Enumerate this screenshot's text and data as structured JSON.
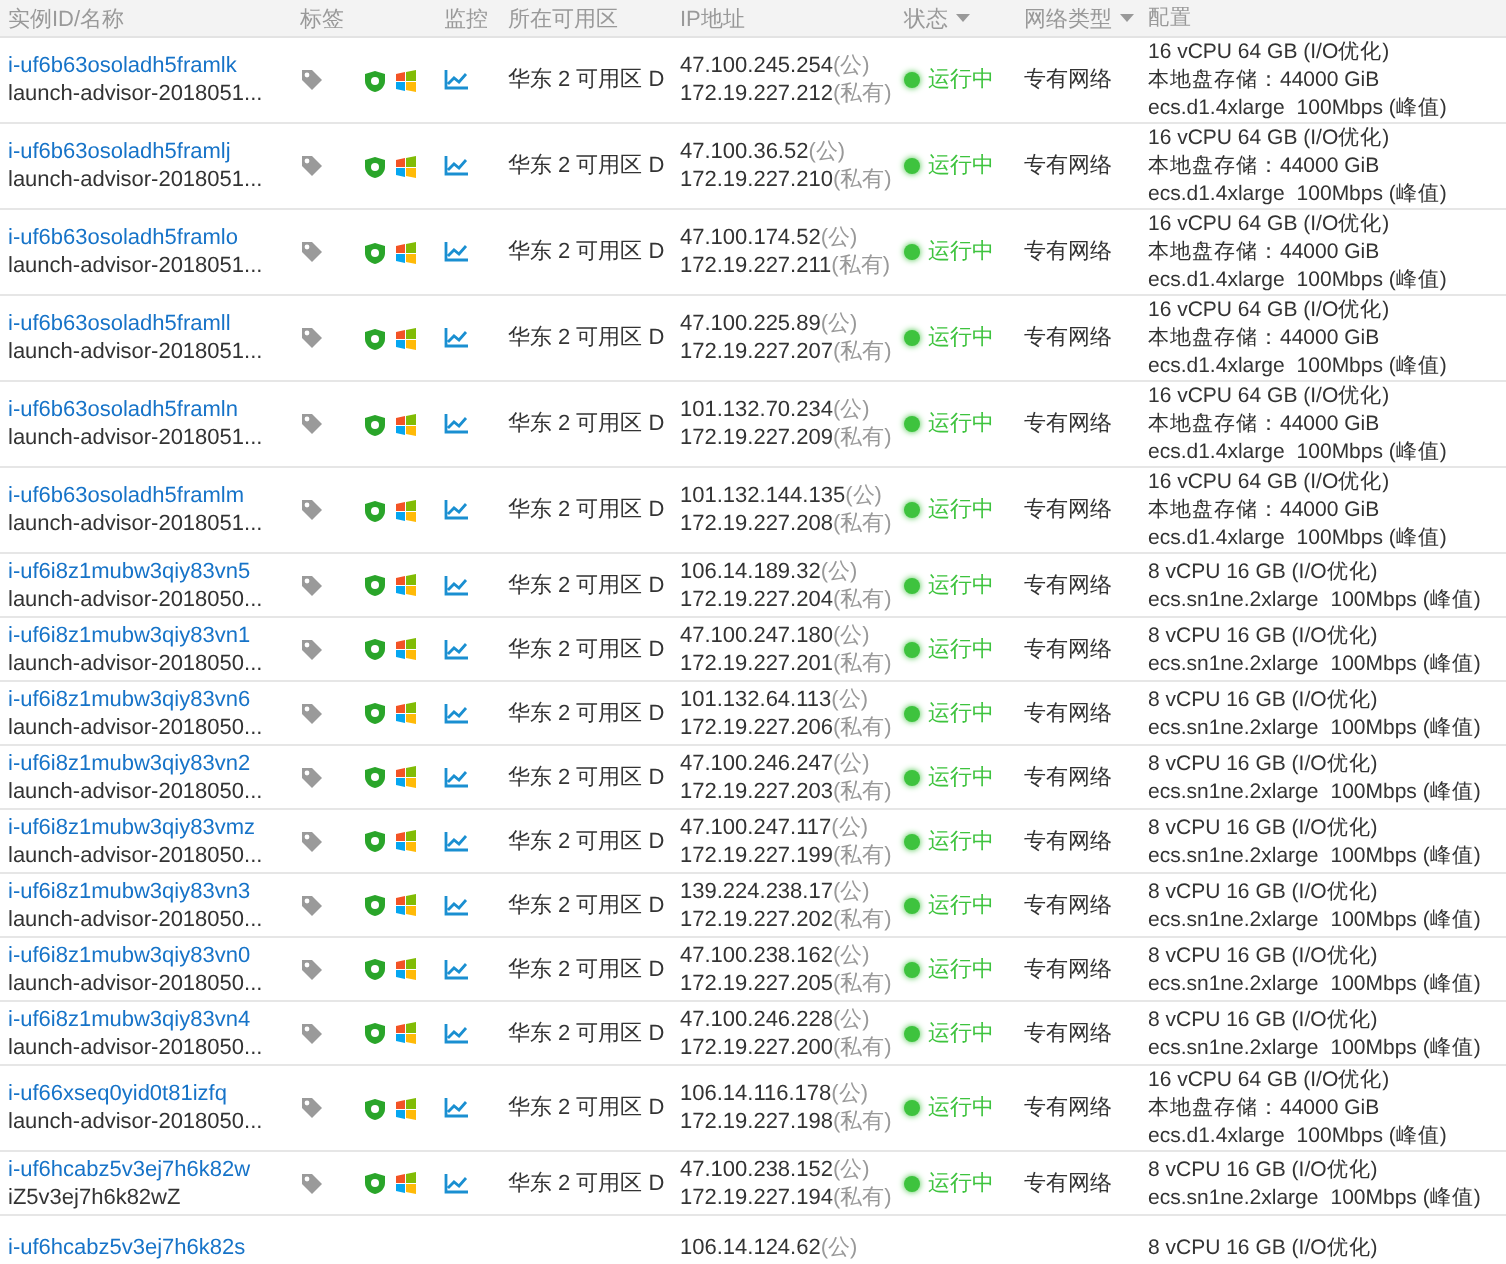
{
  "table": {
    "columns": [
      {
        "label": "实例ID/名称",
        "sortable": false
      },
      {
        "label": "标签",
        "sortable": false
      },
      {
        "label": "监控",
        "sortable": false
      },
      {
        "label": "所在可用区",
        "sortable": false
      },
      {
        "label": "IP地址",
        "sortable": false
      },
      {
        "label": "状态",
        "sortable": true
      },
      {
        "label": "网络类型",
        "sortable": true
      },
      {
        "label": "配置",
        "sortable": false
      }
    ],
    "rows": [
      {
        "id": "i-uf6b63osoladh5framlk",
        "name": "launch-advisor-2018051...",
        "zone": "华东 2 可用区 D",
        "ips": [
          {
            "address": "47.100.245.254",
            "note": "(公)"
          },
          {
            "address": "172.19.227.212",
            "note": "(私有)"
          }
        ],
        "status": {
          "text": "运行中",
          "kind": "running"
        },
        "network": "专有网络",
        "config": {
          "lines": [
            "16 vCPU 64 GB (I/O优化)",
            "本地盘存储：44000 GiB"
          ],
          "spec": "ecs.d1.4xlarge",
          "bandwidth": "100Mbps (峰值)"
        }
      },
      {
        "id": "i-uf6b63osoladh5framlj",
        "name": "launch-advisor-2018051...",
        "zone": "华东 2 可用区 D",
        "ips": [
          {
            "address": "47.100.36.52",
            "note": "(公)"
          },
          {
            "address": "172.19.227.210",
            "note": "(私有)"
          }
        ],
        "status": {
          "text": "运行中",
          "kind": "running"
        },
        "network": "专有网络",
        "config": {
          "lines": [
            "16 vCPU 64 GB (I/O优化)",
            "本地盘存储：44000 GiB"
          ],
          "spec": "ecs.d1.4xlarge",
          "bandwidth": "100Mbps (峰值)"
        }
      },
      {
        "id": "i-uf6b63osoladh5framlo",
        "name": "launch-advisor-2018051...",
        "zone": "华东 2 可用区 D",
        "ips": [
          {
            "address": "47.100.174.52",
            "note": "(公)"
          },
          {
            "address": "172.19.227.211",
            "note": "(私有)"
          }
        ],
        "status": {
          "text": "运行中",
          "kind": "running"
        },
        "network": "专有网络",
        "config": {
          "lines": [
            "16 vCPU 64 GB (I/O优化)",
            "本地盘存储：44000 GiB"
          ],
          "spec": "ecs.d1.4xlarge",
          "bandwidth": "100Mbps (峰值)"
        }
      },
      {
        "id": "i-uf6b63osoladh5framll",
        "name": "launch-advisor-2018051...",
        "zone": "华东 2 可用区 D",
        "ips": [
          {
            "address": "47.100.225.89",
            "note": "(公)"
          },
          {
            "address": "172.19.227.207",
            "note": "(私有)"
          }
        ],
        "status": {
          "text": "运行中",
          "kind": "running"
        },
        "network": "专有网络",
        "config": {
          "lines": [
            "16 vCPU 64 GB (I/O优化)",
            "本地盘存储：44000 GiB"
          ],
          "spec": "ecs.d1.4xlarge",
          "bandwidth": "100Mbps (峰值)"
        }
      },
      {
        "id": "i-uf6b63osoladh5framln",
        "name": "launch-advisor-2018051...",
        "zone": "华东 2 可用区 D",
        "ips": [
          {
            "address": "101.132.70.234",
            "note": "(公)"
          },
          {
            "address": "172.19.227.209",
            "note": "(私有)"
          }
        ],
        "status": {
          "text": "运行中",
          "kind": "running"
        },
        "network": "专有网络",
        "config": {
          "lines": [
            "16 vCPU 64 GB (I/O优化)",
            "本地盘存储：44000 GiB"
          ],
          "spec": "ecs.d1.4xlarge",
          "bandwidth": "100Mbps (峰值)"
        }
      },
      {
        "id": "i-uf6b63osoladh5framlm",
        "name": "launch-advisor-2018051...",
        "zone": "华东 2 可用区 D",
        "ips": [
          {
            "address": "101.132.144.135",
            "note": "(公)"
          },
          {
            "address": "172.19.227.208",
            "note": "(私有)"
          }
        ],
        "status": {
          "text": "运行中",
          "kind": "running"
        },
        "network": "专有网络",
        "config": {
          "lines": [
            "16 vCPU 64 GB (I/O优化)",
            "本地盘存储：44000 GiB"
          ],
          "spec": "ecs.d1.4xlarge",
          "bandwidth": "100Mbps (峰值)"
        }
      },
      {
        "id": "i-uf6i8z1mubw3qiy83vn5",
        "name": "launch-advisor-2018050...",
        "zone": "华东 2 可用区 D",
        "ips": [
          {
            "address": "106.14.189.32",
            "note": "(公)"
          },
          {
            "address": "172.19.227.204",
            "note": "(私有)"
          }
        ],
        "status": {
          "text": "运行中",
          "kind": "running"
        },
        "network": "专有网络",
        "config": {
          "lines": [
            "8 vCPU 16 GB (I/O优化)"
          ],
          "spec": "ecs.sn1ne.2xlarge",
          "bandwidth": "100Mbps (峰值)"
        }
      },
      {
        "id": "i-uf6i8z1mubw3qiy83vn1",
        "name": "launch-advisor-2018050...",
        "zone": "华东 2 可用区 D",
        "ips": [
          {
            "address": "47.100.247.180",
            "note": "(公)"
          },
          {
            "address": "172.19.227.201",
            "note": "(私有)"
          }
        ],
        "status": {
          "text": "运行中",
          "kind": "running"
        },
        "network": "专有网络",
        "config": {
          "lines": [
            "8 vCPU 16 GB (I/O优化)"
          ],
          "spec": "ecs.sn1ne.2xlarge",
          "bandwidth": "100Mbps (峰值)"
        }
      },
      {
        "id": "i-uf6i8z1mubw3qiy83vn6",
        "name": "launch-advisor-2018050...",
        "zone": "华东 2 可用区 D",
        "ips": [
          {
            "address": "101.132.64.113",
            "note": "(公)"
          },
          {
            "address": "172.19.227.206",
            "note": "(私有)"
          }
        ],
        "status": {
          "text": "运行中",
          "kind": "running"
        },
        "network": "专有网络",
        "config": {
          "lines": [
            "8 vCPU 16 GB (I/O优化)"
          ],
          "spec": "ecs.sn1ne.2xlarge",
          "bandwidth": "100Mbps (峰值)"
        }
      },
      {
        "id": "i-uf6i8z1mubw3qiy83vn2",
        "name": "launch-advisor-2018050...",
        "zone": "华东 2 可用区 D",
        "ips": [
          {
            "address": "47.100.246.247",
            "note": "(公)"
          },
          {
            "address": "172.19.227.203",
            "note": "(私有)"
          }
        ],
        "status": {
          "text": "运行中",
          "kind": "running"
        },
        "network": "专有网络",
        "config": {
          "lines": [
            "8 vCPU 16 GB (I/O优化)"
          ],
          "spec": "ecs.sn1ne.2xlarge",
          "bandwidth": "100Mbps (峰值)"
        }
      },
      {
        "id": "i-uf6i8z1mubw3qiy83vmz",
        "name": "launch-advisor-2018050...",
        "zone": "华东 2 可用区 D",
        "ips": [
          {
            "address": "47.100.247.117",
            "note": "(公)"
          },
          {
            "address": "172.19.227.199",
            "note": "(私有)"
          }
        ],
        "status": {
          "text": "运行中",
          "kind": "running"
        },
        "network": "专有网络",
        "config": {
          "lines": [
            "8 vCPU 16 GB (I/O优化)"
          ],
          "spec": "ecs.sn1ne.2xlarge",
          "bandwidth": "100Mbps (峰值)"
        }
      },
      {
        "id": "i-uf6i8z1mubw3qiy83vn3",
        "name": "launch-advisor-2018050...",
        "zone": "华东 2 可用区 D",
        "ips": [
          {
            "address": "139.224.238.17",
            "note": "(公)"
          },
          {
            "address": "172.19.227.202",
            "note": "(私有)"
          }
        ],
        "status": {
          "text": "运行中",
          "kind": "running"
        },
        "network": "专有网络",
        "config": {
          "lines": [
            "8 vCPU 16 GB (I/O优化)"
          ],
          "spec": "ecs.sn1ne.2xlarge",
          "bandwidth": "100Mbps (峰值)"
        }
      },
      {
        "id": "i-uf6i8z1mubw3qiy83vn0",
        "name": "launch-advisor-2018050...",
        "zone": "华东 2 可用区 D",
        "ips": [
          {
            "address": "47.100.238.162",
            "note": "(公)"
          },
          {
            "address": "172.19.227.205",
            "note": "(私有)"
          }
        ],
        "status": {
          "text": "运行中",
          "kind": "running"
        },
        "network": "专有网络",
        "config": {
          "lines": [
            "8 vCPU 16 GB (I/O优化)"
          ],
          "spec": "ecs.sn1ne.2xlarge",
          "bandwidth": "100Mbps (峰值)"
        }
      },
      {
        "id": "i-uf6i8z1mubw3qiy83vn4",
        "name": "launch-advisor-2018050...",
        "zone": "华东 2 可用区 D",
        "ips": [
          {
            "address": "47.100.246.228",
            "note": "(公)"
          },
          {
            "address": "172.19.227.200",
            "note": "(私有)"
          }
        ],
        "status": {
          "text": "运行中",
          "kind": "running"
        },
        "network": "专有网络",
        "config": {
          "lines": [
            "8 vCPU 16 GB (I/O优化)"
          ],
          "spec": "ecs.sn1ne.2xlarge",
          "bandwidth": "100Mbps (峰值)"
        }
      },
      {
        "id": "i-uf66xseq0yid0t81izfq",
        "name": "launch-advisor-2018050...",
        "zone": "华东 2 可用区 D",
        "ips": [
          {
            "address": "106.14.116.178",
            "note": "(公)"
          },
          {
            "address": "172.19.227.198",
            "note": "(私有)"
          }
        ],
        "status": {
          "text": "运行中",
          "kind": "running"
        },
        "network": "专有网络",
        "config": {
          "lines": [
            "16 vCPU 64 GB (I/O优化)",
            "本地盘存储：44000 GiB"
          ],
          "spec": "ecs.d1.4xlarge",
          "bandwidth": "100Mbps (峰值)"
        }
      },
      {
        "id": "i-uf6hcabz5v3ej7h6k82w",
        "name": "iZ5v3ej7h6k82wZ",
        "zone": "华东 2 可用区 D",
        "ips": [
          {
            "address": "47.100.238.152",
            "note": "(公)"
          },
          {
            "address": "172.19.227.194",
            "note": "(私有)"
          }
        ],
        "status": {
          "text": "运行中",
          "kind": "running"
        },
        "network": "专有网络",
        "config": {
          "lines": [
            "8 vCPU 16 GB (I/O优化)"
          ],
          "spec": "ecs.sn1ne.2xlarge",
          "bandwidth": "100Mbps (峰值)"
        }
      },
      {
        "id": "i-uf6hcabz5v3ej7h6k82s",
        "ips": [
          {
            "address": "106.14.124.62",
            "note": "(公)"
          }
        ],
        "config": {
          "lines": [
            "8 vCPU 16 GB (I/O优化)"
          ]
        }
      }
    ]
  }
}
